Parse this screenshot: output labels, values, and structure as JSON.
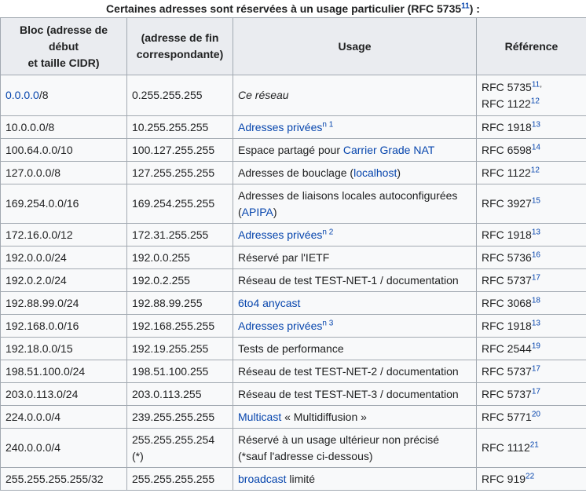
{
  "caption": {
    "text": "Certaines adresses sont réservées à un usage particulier (RFC 5735",
    "ref": "11",
    "tail": ") :"
  },
  "headers": {
    "bloc_line1": "Bloc (adresse de",
    "bloc_line2": "début",
    "bloc_line3": "et taille CIDR)",
    "fin_line1": "(adresse de fin",
    "fin_line2": "correspondante)",
    "usage": "Usage",
    "reference": "Référence"
  },
  "rows": [
    {
      "bloc_link": "0.0.0.0",
      "bloc_rest": "/8",
      "fin": "0.255.255.255",
      "usage": "Ce réseau",
      "ref1": "RFC 5735",
      "ref1_sup": "11",
      "ref1_tail": ",",
      "ref2": "RFC 1122",
      "ref2_sup": "12"
    },
    {
      "bloc": "10.0.0.0/8",
      "fin": "10.255.255.255",
      "usage_link": "Adresses privées",
      "usage_sup": "n 1",
      "ref": "RFC 1918",
      "ref_sup": "13"
    },
    {
      "bloc": "100.64.0.0/10",
      "fin": "100.127.255.255",
      "usage_pre": "Espace partagé pour ",
      "usage_link": "Carrier Grade NAT",
      "ref": "RFC 6598",
      "ref_sup": "14"
    },
    {
      "bloc": "127.0.0.0/8",
      "fin": "127.255.255.255",
      "usage_pre": "Adresses de bouclage (",
      "usage_link": "localhost",
      "usage_post": ")",
      "ref": "RFC 1122",
      "ref_sup": "12"
    },
    {
      "bloc": "169.254.0.0/16",
      "fin": "169.254.255.255",
      "usage_line1": "Adresses de liaisons locales autoconfigurées",
      "usage_pre2": "(",
      "usage_link": "APIPA",
      "usage_post": ")",
      "ref": "RFC 3927",
      "ref_sup": "15"
    },
    {
      "bloc": "172.16.0.0/12",
      "fin": "172.31.255.255",
      "usage_link": "Adresses privées",
      "usage_sup": "n 2",
      "ref": "RFC 1918",
      "ref_sup": "13"
    },
    {
      "bloc": "192.0.0.0/24",
      "fin": "192.0.0.255",
      "usage": "Réservé par l'IETF",
      "ref": "RFC 5736",
      "ref_sup": "16"
    },
    {
      "bloc": "192.0.2.0/24",
      "fin": "192.0.2.255",
      "usage": "Réseau de test TEST-NET-1 / documentation",
      "ref": "RFC 5737",
      "ref_sup": "17"
    },
    {
      "bloc": "192.88.99.0/24",
      "fin": "192.88.99.255",
      "usage_link": "6to4 anycast",
      "ref": "RFC 3068",
      "ref_sup": "18"
    },
    {
      "bloc": "192.168.0.0/16",
      "fin": "192.168.255.255",
      "usage_link": "Adresses privées",
      "usage_sup": "n 3",
      "ref": "RFC 1918",
      "ref_sup": "13"
    },
    {
      "bloc": "192.18.0.0/15",
      "fin": "192.19.255.255",
      "usage": "Tests de performance",
      "ref": "RFC 2544",
      "ref_sup": "19"
    },
    {
      "bloc": "198.51.100.0/24",
      "fin": "198.51.100.255",
      "usage": "Réseau de test TEST-NET-2 / documentation",
      "ref": "RFC 5737",
      "ref_sup": "17"
    },
    {
      "bloc": "203.0.113.0/24",
      "fin": "203.0.113.255",
      "usage": "Réseau de test TEST-NET-3 / documentation",
      "ref": "RFC 5737",
      "ref_sup": "17"
    },
    {
      "bloc": "224.0.0.0/4",
      "fin": "239.255.255.255",
      "usage_link": "Multicast",
      "usage_post": " « Multidiffusion »",
      "ref": "RFC 5771",
      "ref_sup": "20"
    },
    {
      "bloc": "240.0.0.0/4",
      "fin_line1": "255.255.255.254",
      "fin_line2": "(*)",
      "usage_line1": "Réservé à un usage ultérieur non précisé",
      "usage_line2": "(*sauf l'adresse ci-dessous)",
      "ref": "RFC 1112",
      "ref_sup": "21"
    },
    {
      "bloc": "255.255.255.255/32",
      "fin": "255.255.255.255",
      "usage_link": "broadcast",
      "usage_post": " limité",
      "ref": "RFC 919",
      "ref_sup": "22"
    }
  ],
  "colors": {
    "link": "#0645ad",
    "header_bg": "#eaecf0",
    "cell_bg": "#f8f9fa",
    "border": "#a2a9b1"
  }
}
